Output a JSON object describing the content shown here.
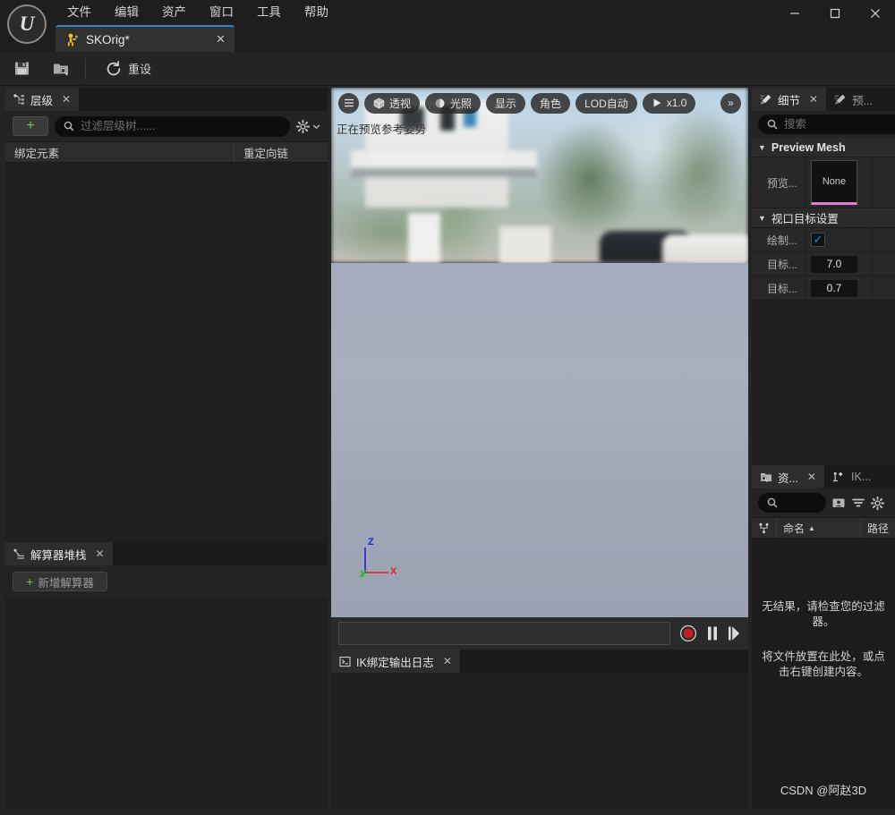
{
  "titlebar": {
    "logo": "ue-logo",
    "menus": [
      {
        "label": "文件",
        "name": "menu-file"
      },
      {
        "label": "编辑",
        "name": "menu-edit"
      },
      {
        "label": "资产",
        "name": "menu-assets"
      },
      {
        "label": "窗口",
        "name": "menu-window"
      },
      {
        "label": "工具",
        "name": "menu-tools"
      },
      {
        "label": "帮助",
        "name": "menu-help"
      }
    ],
    "document_tab": {
      "label": "SKOrig*",
      "close": "✕"
    },
    "window_controls": {
      "minimize": "—",
      "maximize": "□",
      "close": "✕"
    }
  },
  "toolbar": {
    "save_label": "",
    "browse_label": "",
    "reset_label": "重设"
  },
  "hierarchy": {
    "tab_label": "层级",
    "tab_close": "✕",
    "add_label": "+",
    "search_placeholder": "过滤层级树......",
    "search_value": "",
    "columns": [
      {
        "label": "绑定元素"
      },
      {
        "label": "重定向链"
      }
    ]
  },
  "solver": {
    "tab_label": "解算器堆栈",
    "tab_close": "✕",
    "add_label": "新增解算器",
    "add_plus": "+"
  },
  "viewport": {
    "menu_icon": "☰",
    "pills": [
      {
        "label": "透视",
        "icon": "cube-icon",
        "name": "viewport-perspective-button"
      },
      {
        "label": "光照",
        "icon": "lighting-icon",
        "name": "viewport-lighting-button"
      },
      {
        "label": "显示",
        "icon": "",
        "name": "viewport-show-button"
      },
      {
        "label": "角色",
        "icon": "",
        "name": "viewport-character-button"
      },
      {
        "label": "LOD自动",
        "icon": "",
        "name": "viewport-lod-button"
      },
      {
        "label": "x1.0",
        "icon": "play-icon",
        "name": "viewport-playrate-button"
      }
    ],
    "overflow": "»",
    "status_text": "正在预览参考姿势",
    "gizmo": {
      "z": "Z",
      "x": "X",
      "y": "Y",
      "z_color": "#2222dd",
      "x_color": "#dd2222",
      "y_color": "#22bb22"
    }
  },
  "transport": {
    "field_value": "",
    "record": "record-icon",
    "pause": "pause-icon",
    "step": "step-forward-icon"
  },
  "iklog": {
    "tab_label": "IK绑定输出日志",
    "tab_close": "✕"
  },
  "details": {
    "tabs": [
      {
        "label": "细节",
        "close": "✕",
        "active": true,
        "name": "tab-details"
      },
      {
        "label": "预...",
        "close": "",
        "active": false,
        "name": "tab-preview"
      }
    ],
    "search_placeholder": "搜索",
    "search_value": "",
    "sections": [
      {
        "title": "Preview Mesh",
        "bold": true,
        "rows": [
          {
            "key": "预览...",
            "type": "thumb",
            "value": "None",
            "accent": "#e07fd0"
          }
        ]
      },
      {
        "title": "视口目标设置",
        "bold": false,
        "rows": [
          {
            "key": "绘制...",
            "type": "check",
            "value": "✓"
          },
          {
            "key": "目标...",
            "type": "num",
            "value": "7.0"
          },
          {
            "key": "目标...",
            "type": "num",
            "value": "0.7"
          }
        ]
      }
    ]
  },
  "assets": {
    "tabs": [
      {
        "label": "资...",
        "close": "✕",
        "active": true,
        "name": "tab-asset-browser"
      },
      {
        "label": "IK...",
        "close": "",
        "active": false,
        "name": "tab-ik-retargeter"
      }
    ],
    "search_value": "",
    "columns": [
      {
        "label": "",
        "icon": "hierarchy-icon"
      },
      {
        "label": "命名",
        "sort": "▲"
      },
      {
        "label": "路径"
      }
    ],
    "empty_text_1": "无结果，请检查您的过滤器。",
    "empty_text_2": "将文件放置在此处，或点击右键创建内容。",
    "watermark": "CSDN @阿赵3D"
  }
}
